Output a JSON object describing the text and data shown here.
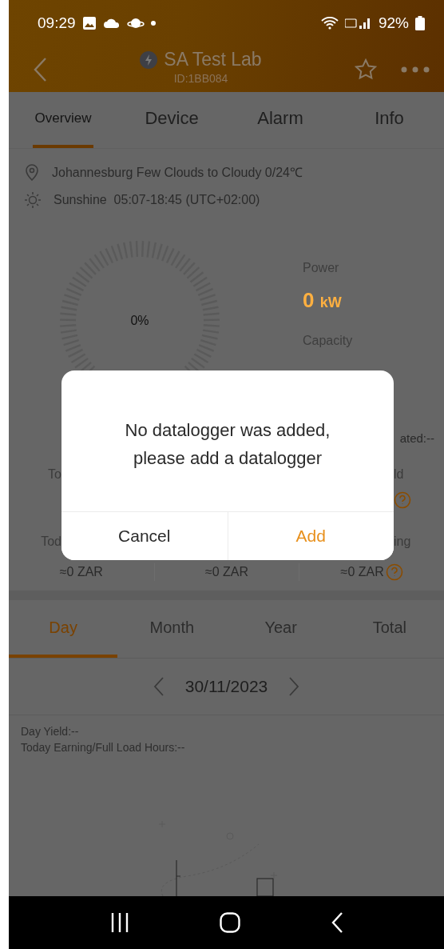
{
  "status_bar": {
    "time": "09:29",
    "battery": "92%"
  },
  "header": {
    "title": "SA Test Lab",
    "id": "ID:1BB084"
  },
  "tabs": [
    {
      "label": "Overview",
      "selected": true
    },
    {
      "label": "Device",
      "selected": false
    },
    {
      "label": "Alarm",
      "selected": false
    },
    {
      "label": "Info",
      "selected": false
    }
  ],
  "location": "Johannesburg Few Clouds to Cloudy 0/24℃",
  "sunshine": "Sunshine  05:07-18:45 (UTC+02:00)",
  "gauge": {
    "percent": "0%"
  },
  "power": {
    "label": "Power",
    "value": "0",
    "unit": "kW"
  },
  "capacity": {
    "label": "Capacity"
  },
  "updated": "ated:--",
  "stat_rows": [
    {
      "left_label": "To",
      "right_label": "ld",
      "values": [],
      "help": true
    },
    {
      "left_label": "Tod",
      "right_label": "ing",
      "values": [
        "≈0 ZAR",
        "≈0 ZAR",
        "≈0 ZAR"
      ],
      "help": true
    }
  ],
  "dialog": {
    "message": "No datalogger was added, please add a datalogger",
    "buttons": [
      {
        "label": "Cancel",
        "kind": "secondary"
      },
      {
        "label": "Add",
        "kind": "primary"
      }
    ]
  },
  "period_tabs": [
    {
      "label": "Day",
      "selected": true
    },
    {
      "label": "Month",
      "selected": false
    },
    {
      "label": "Year",
      "selected": false
    },
    {
      "label": "Total",
      "selected": false
    }
  ],
  "date": "30/11/2023",
  "summary": [
    "Day Yield:--",
    "Today Earning/Full Load Hours:--"
  ]
}
